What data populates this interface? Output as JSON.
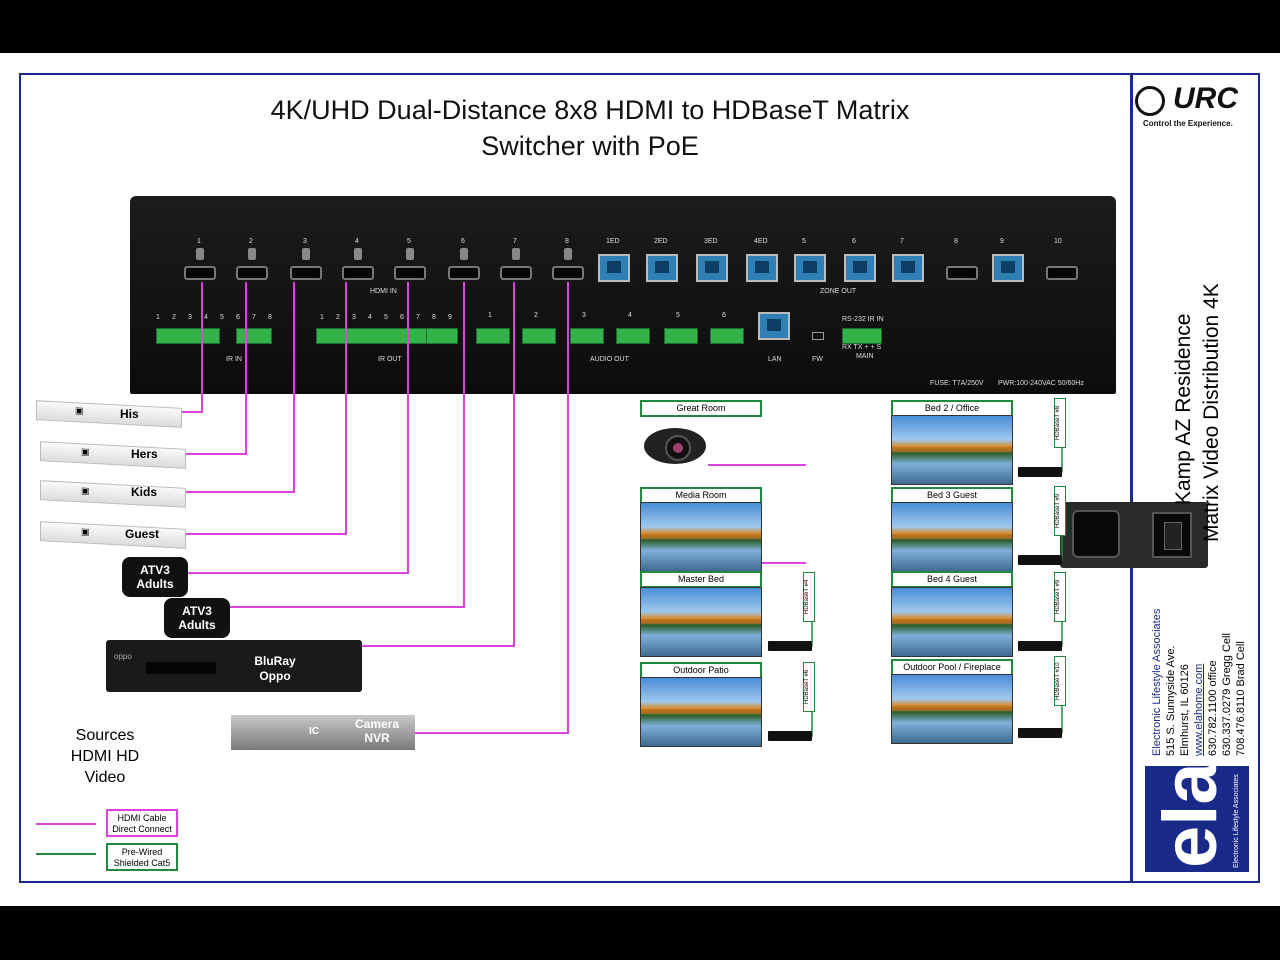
{
  "title": {
    "line1": "4K/UHD Dual-Distance 8x8 HDMI to HDBaseT Matrix",
    "line2": "Switcher with PoE"
  },
  "device": {
    "hdmi_in_numbers": [
      "1",
      "2",
      "3",
      "4",
      "5",
      "6",
      "7",
      "8"
    ],
    "hdmi_in_label": "HDMI IN",
    "zone_out_numbers": [
      "1ED",
      "2ED",
      "3ED",
      "4ED",
      "5",
      "6",
      "7",
      "8",
      "9",
      "10"
    ],
    "zone_out_label": "ZONE OUT",
    "ir_in_numbers": [
      "1",
      "2",
      "3",
      "4",
      "5",
      "6",
      "7",
      "8"
    ],
    "ir_in_label": "IR IN",
    "ir_out_numbers": [
      "1",
      "2",
      "3",
      "4",
      "5",
      "6",
      "7",
      "8",
      "9"
    ],
    "ir_out_label": "IR OUT",
    "audio_out_label": "AUDIO OUT",
    "audio_out_numbers": [
      "1",
      "2",
      "3",
      "4",
      "5",
      "6"
    ],
    "lan_label": "LAN",
    "fw_label": "FW",
    "rs232_label": "RS-232 IR IN",
    "rs232_pins": "RX TX + + S",
    "main_label": "MAIN",
    "fuse_label": "FUSE: T7A/250V",
    "pwr_label": "PWR:100-240VAC 50/60Hz"
  },
  "sources": [
    {
      "name": "His"
    },
    {
      "name": "Hers"
    },
    {
      "name": "Kids"
    },
    {
      "name": "Guest"
    },
    {
      "name": "ATV3\nAdults"
    },
    {
      "name": "ATV3\nAdults"
    },
    {
      "name": "BluRay\nOppo"
    },
    {
      "name": "Camera\nNVR"
    }
  ],
  "oppo_brand": "oppo",
  "nvr_brand": "IC",
  "sources_caption": "Sources\nHDMI HD\nVideo",
  "rooms": [
    {
      "name": "Great Room"
    },
    {
      "name": "Media Room"
    },
    {
      "name": "Master Bed",
      "hdbt": "HDBaseT #4"
    },
    {
      "name": "Outdoor Patio",
      "hdbt": "HDBaseT #6"
    },
    {
      "name": "Bed 2 / Office",
      "hdbt": "HDBaseT #8"
    },
    {
      "name": "Bed 3 Guest",
      "hdbt": "HDBaseT #9"
    },
    {
      "name": "Bed 4 Guest",
      "hdbt": "HDBaseT #9"
    },
    {
      "name": "Outdoor Pool / Fireplace",
      "hdbt": "HDBaseT #10"
    }
  ],
  "legend": [
    {
      "label": "HDMI Cable\nDirect Connect",
      "color": "#e040e0"
    },
    {
      "label": "Pre-Wired\nShielded Cat5",
      "color": "#1f8a3a"
    }
  ],
  "project": {
    "line1": "Kamp AZ Residence",
    "line2": "Matrix Video Distribution 4K"
  },
  "company": {
    "name": "Electronic Lifestyle Associates",
    "address1": "515 S. Sunnyside Ave.",
    "address2": "Elmhurst, IL 60126",
    "web": "www.elahome.com",
    "phone1": "630.782.1100 office",
    "phone2": "630.337.0279 Gregg Cell",
    "phone3": "708.476.8110 Brad Cell",
    "logo_text": "ela",
    "logo_sub": "Electronic Lifestyle Associates"
  },
  "urc": {
    "logo_text": "URC",
    "tagline": "Control the Experience."
  },
  "colors": {
    "hdmi_wire": "#e040e0",
    "cat5_wire": "#1f8a3a",
    "frame": "#1a2a8a"
  }
}
